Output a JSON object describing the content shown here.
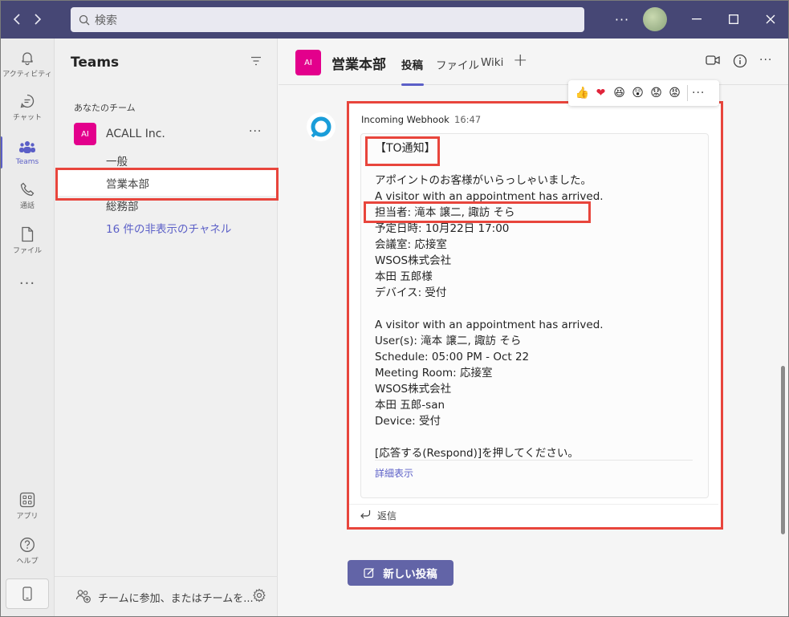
{
  "titlebar": {
    "search_placeholder": "検索",
    "more": "···"
  },
  "rail": {
    "items": [
      {
        "label": "アクティビティ",
        "icon": "bell-icon"
      },
      {
        "label": "チャット",
        "icon": "chat-icon"
      },
      {
        "label": "Teams",
        "icon": "teams-icon"
      },
      {
        "label": "通話",
        "icon": "phone-icon"
      },
      {
        "label": "ファイル",
        "icon": "file-icon"
      }
    ],
    "more": "···",
    "apps_label": "アプリ",
    "help_label": "ヘルプ"
  },
  "panel": {
    "title": "Teams",
    "section_label": "あなたのチーム",
    "team": {
      "avatar": "AI",
      "name": "ACALL Inc.",
      "more": "···"
    },
    "channels": [
      "一般",
      "営業本部",
      "総務部"
    ],
    "hidden_channels": "16 件の非表示のチャネル",
    "join_text": "チームに参加、またはチームを..."
  },
  "channel": {
    "avatar": "AI",
    "title": "営業本部",
    "tabs": [
      "投稿",
      "ファイル",
      "Wiki"
    ],
    "add_tab": "+"
  },
  "reactions": [
    "👍",
    "❤",
    "😆",
    "😲",
    "😟",
    "😡"
  ],
  "reactions_more": "···",
  "message": {
    "sender": "Incoming Webhook",
    "time": "16:47",
    "lines": [
      "【TO通知】",
      "",
      "アポイントのお客様がいらっしゃいました。",
      "A visitor with an appointment has arrived.",
      "担当者: 滝本 譲二, 諏訪 そら",
      "予定日時: 10月22日 17:00",
      "会議室: 応接室",
      "WSOS株式会社",
      "本田 五郎様",
      "デバイス: 受付",
      "",
      "A visitor with an appointment has arrived.",
      "User(s): 滝本 譲二, 諏訪 そら",
      "Schedule: 05:00 PM - Oct 22",
      "Meeting Room: 応接室",
      "WSOS株式会社",
      "本田 五郎-san",
      "Device: 受付",
      "",
      "[応答する(Respond)]を押してください。"
    ],
    "see_more": "詳細表示",
    "reply": "返信"
  },
  "new_post": "新しい投稿",
  "colors": {
    "titlebar": "#464775",
    "accent": "#5b5fc7",
    "team_avatar": "#e3008c",
    "highlight": "#e8453c",
    "button": "#6264a7"
  }
}
